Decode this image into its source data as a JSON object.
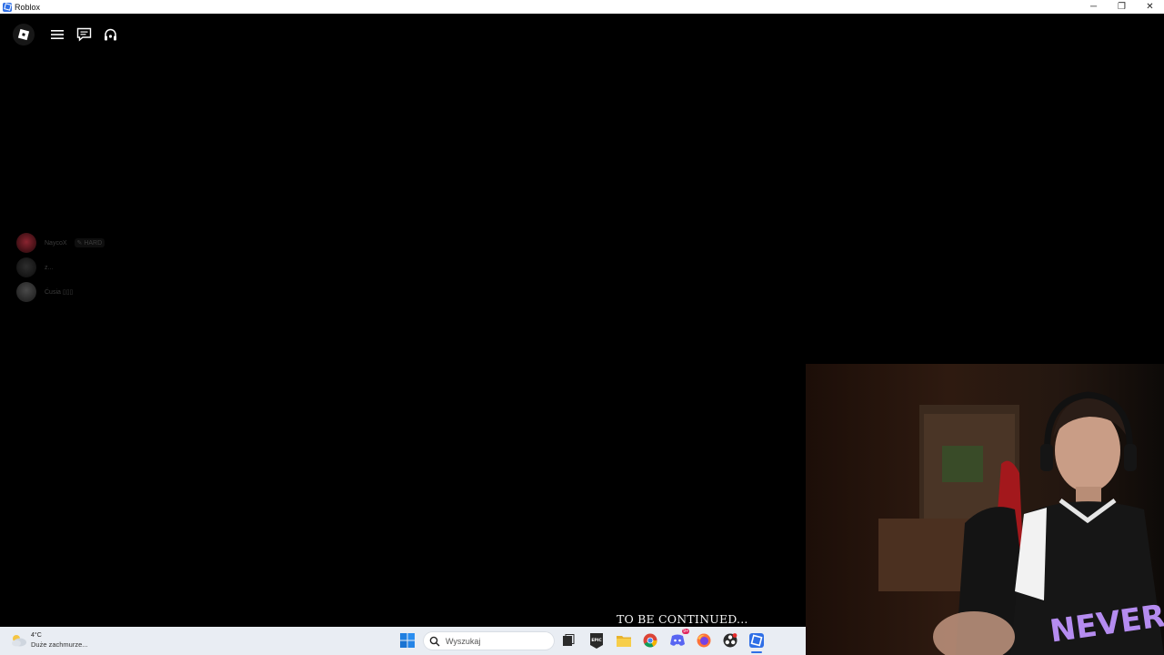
{
  "window": {
    "title": "Roblox",
    "controls": {
      "minimize": "─",
      "restore": "❐",
      "close": "✕"
    }
  },
  "roblox_topbar": {
    "icons": [
      "roblox-logo-icon",
      "menu-icon",
      "chat-icon",
      "voice-icon"
    ]
  },
  "players": [
    {
      "name": "NaycoX",
      "badge": "HARD",
      "avatar_color": "#5a1a1e"
    },
    {
      "name": "z...",
      "badge": "",
      "avatar_color": "#1c1c1c"
    },
    {
      "name": "Ćusia ▯▯▯",
      "badge": "",
      "avatar_color": "#2a2a2a"
    }
  ],
  "caption": {
    "text": "TO BE CONTINUED..."
  },
  "taskbar": {
    "weather": {
      "temp": "4°C",
      "description": "Duże zachmurze..."
    },
    "search": {
      "placeholder": "Wyszukaj"
    },
    "apps": [
      "windows-start-icon",
      "search-icon",
      "task-view-icon",
      "epic-games-icon",
      "file-explorer-icon",
      "chrome-icon",
      "discord-icon",
      "firefox-icon",
      "obs-icon",
      "roblox-taskbar-icon"
    ],
    "discord_badge": "9+"
  },
  "colors": {
    "background": "#000000",
    "taskbar": "#e9edf3",
    "accent_blue": "#2f6fe6"
  }
}
